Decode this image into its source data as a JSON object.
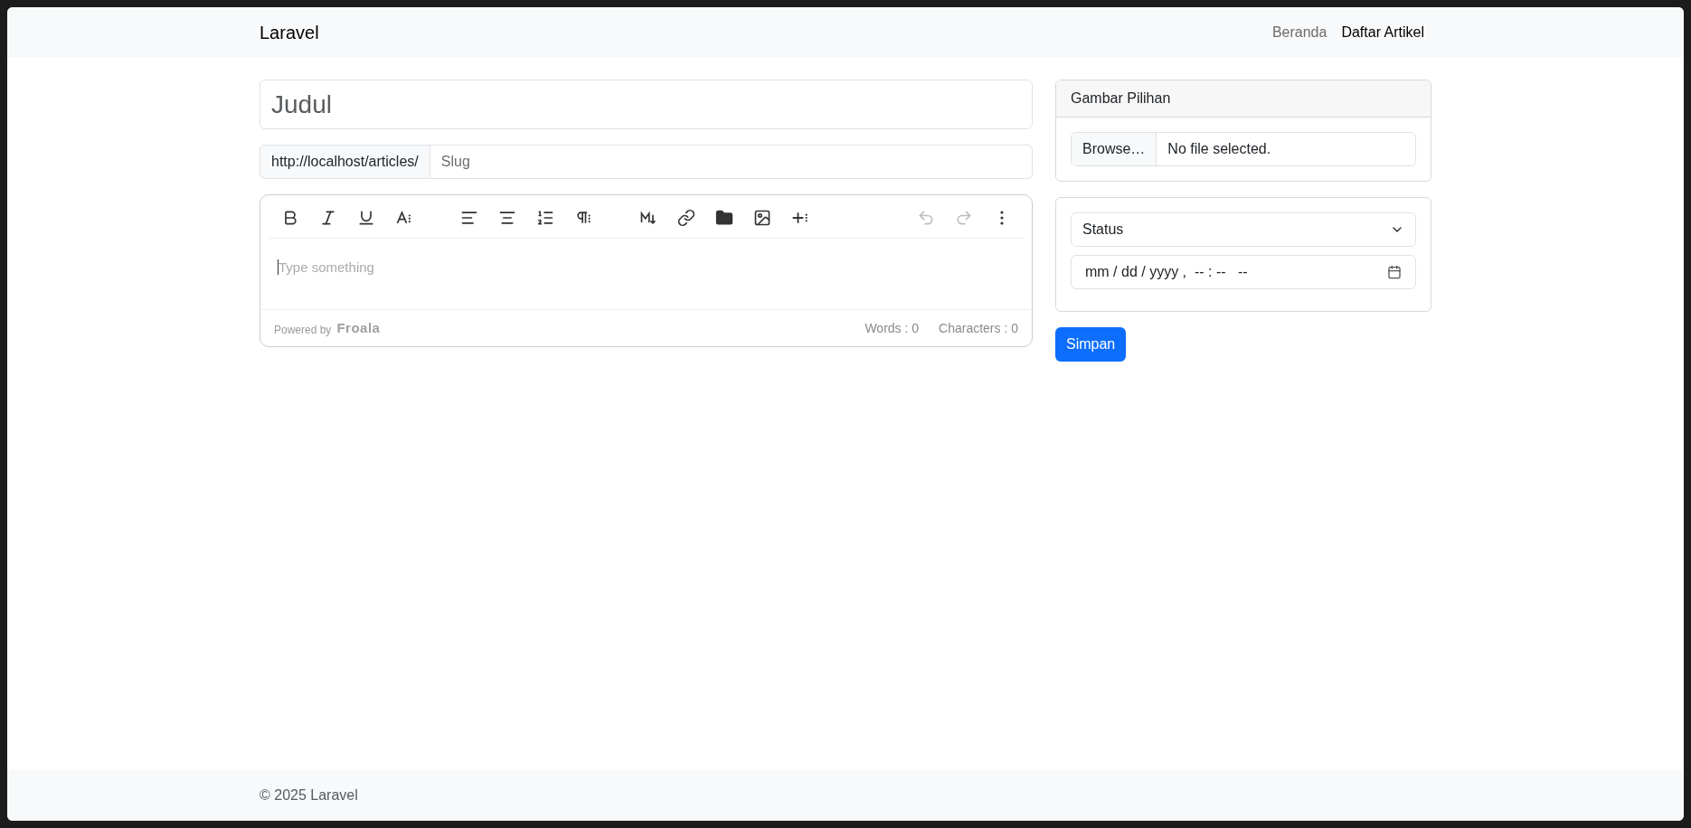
{
  "navbar": {
    "brand": "Laravel",
    "links": [
      {
        "label": "Beranda",
        "selected": false
      },
      {
        "label": "Daftar Artikel",
        "selected": true
      }
    ]
  },
  "title_field": {
    "placeholder": "Judul"
  },
  "slug_field": {
    "prefix": "http://localhost/articles/",
    "placeholder": "Slug"
  },
  "editor": {
    "toolbar": [
      {
        "disabled": false
      },
      {
        "disabled": false
      },
      {
        "disabled": false
      },
      {
        "disabled": false
      },
      {
        "disabled": false
      },
      {
        "disabled": false
      },
      {
        "disabled": false
      },
      {
        "disabled": false
      },
      {
        "disabled": false
      },
      {
        "disabled": false
      },
      {
        "disabled": false
      },
      {
        "disabled": false
      },
      {
        "disabled": false
      },
      {
        "disabled": true
      },
      {
        "disabled": true
      },
      {
        "disabled": false
      }
    ],
    "placeholder": "Type something",
    "powered_by": "Powered by",
    "brand": "Froala",
    "words": "Words : 0",
    "characters": "Characters : 0"
  },
  "featured_image_card": {
    "header": "Gambar Pilihan",
    "browse_button": "Browse…",
    "file_status": "No file selected."
  },
  "publish_card": {
    "status_select": "Status",
    "datetime_field": "mm / dd / yyyy ,  -- : --   --"
  },
  "save_button": "Simpan",
  "footer": {
    "copyright": "© 2025 Laravel"
  }
}
